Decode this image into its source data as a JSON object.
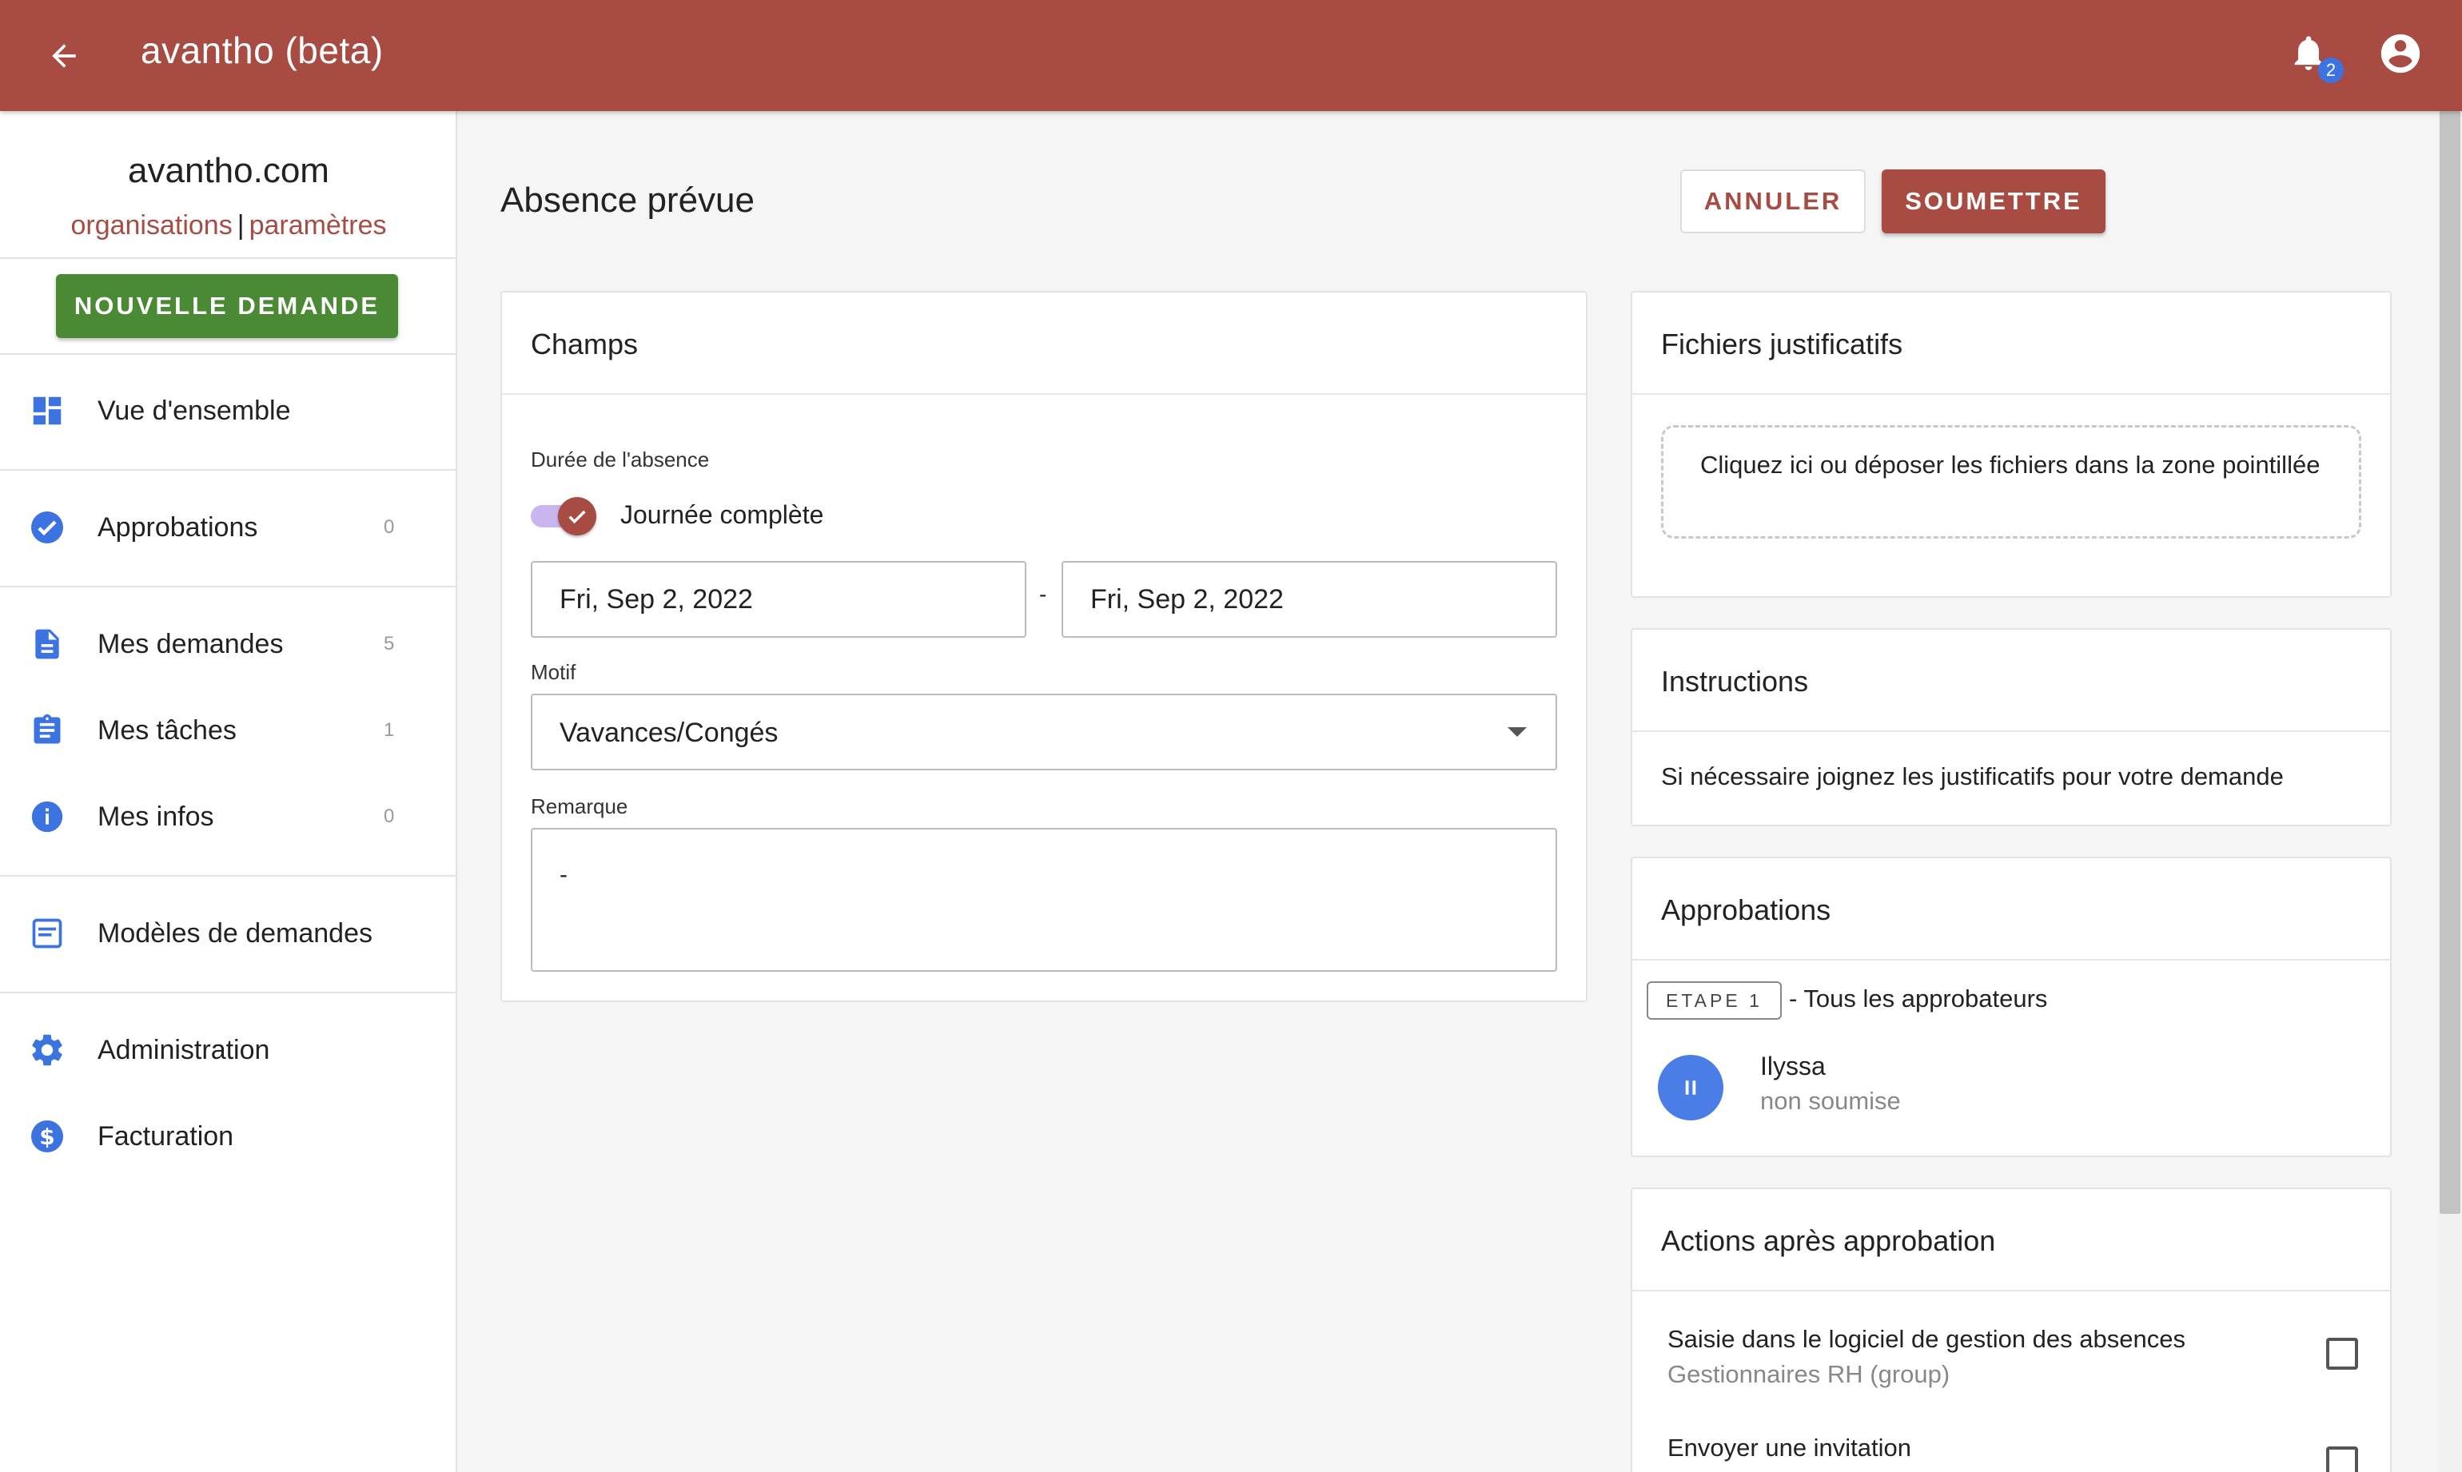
{
  "app": {
    "title": "avantho (beta)",
    "notification_count": "2",
    "accent_color": "#a84b42"
  },
  "sidebar": {
    "org_name": "avantho.com",
    "link_organisations": "organisations",
    "link_separator": "|",
    "link_parametres": "paramètres",
    "new_request_label": "NOUVELLE DEMANDE",
    "items": [
      {
        "label": "Vue d'ensemble",
        "icon": "dashboard-icon",
        "count": ""
      },
      {
        "label": "Approbations",
        "icon": "check-circle-icon",
        "count": "0"
      },
      {
        "label": "Mes demandes",
        "icon": "document-icon",
        "count": "5"
      },
      {
        "label": "Mes tâches",
        "icon": "clipboard-icon",
        "count": "1"
      },
      {
        "label": "Mes infos",
        "icon": "info-icon",
        "count": "0"
      },
      {
        "label": "Modèles de demandes",
        "icon": "template-icon",
        "count": ""
      },
      {
        "label": "Administration",
        "icon": "gear-icon",
        "count": ""
      },
      {
        "label": "Facturation",
        "icon": "dollar-icon",
        "count": ""
      }
    ]
  },
  "main": {
    "page_title": "Absence prévue",
    "cancel_label": "ANNULER",
    "submit_label": "SOUMETTRE",
    "fields_card": {
      "title": "Champs",
      "duration_label": "Durée de l'absence",
      "full_day_label": "Journée complète",
      "full_day_checked": true,
      "date_start": "Fri, Sep 2, 2022",
      "date_separator": "-",
      "date_end": "Fri, Sep 2, 2022",
      "reason_label": "Motif",
      "reason_value": "Vavances/Congés",
      "remark_label": "Remarque",
      "remark_value": "-"
    }
  },
  "right": {
    "files_card": {
      "title": "Fichiers justificatifs",
      "dropzone_text": "Cliquez ici ou déposer les fichiers dans la zone pointillée"
    },
    "instructions_card": {
      "title": "Instructions",
      "text": "Si nécessaire joignez les justificatifs pour votre demande"
    },
    "approvals_card": {
      "title": "Approbations",
      "step_label": "ETAPE 1",
      "step_desc": "- Tous les approbateurs",
      "approver_name": "Ilyssa",
      "approver_status": "non soumise"
    },
    "actions_card": {
      "title": "Actions après approbation",
      "actions": [
        {
          "title": "Saisie dans le logiciel de gestion des absences",
          "subtitle": "Gestionnaires RH (group)",
          "checked": false
        },
        {
          "title": "Envoyer une invitation",
          "subtitle": "",
          "checked": false
        }
      ]
    }
  }
}
